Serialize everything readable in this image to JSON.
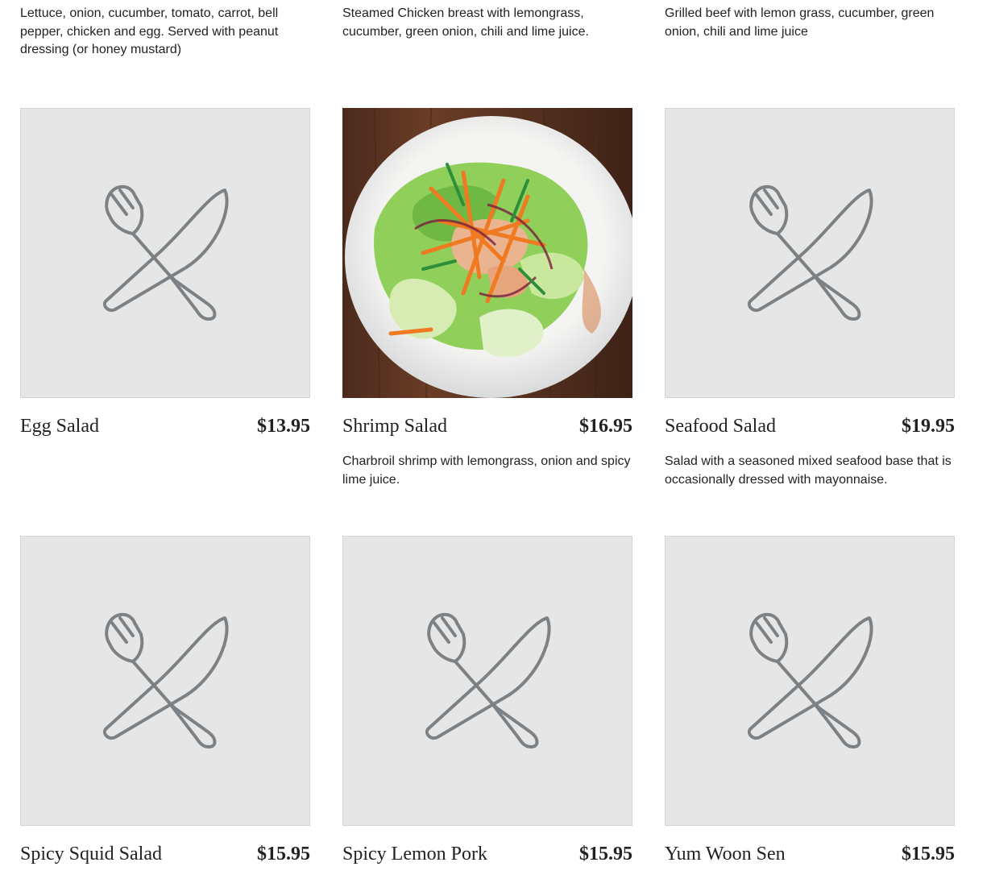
{
  "top_descriptions": [
    "Lettuce, onion, cucumber, tomato, carrot, bell pepper, chicken and egg. Served with peanut dressing (or honey mustard)",
    "Steamed Chicken breast with lemongrass, cucumber, green onion, chili and lime juice.",
    "Grilled beef with lemon grass, cucumber, green onion, chili and lime juice"
  ],
  "items": [
    {
      "name": "Egg Salad",
      "price": "$13.95",
      "description": "",
      "image": "placeholder-fork-knife-icon"
    },
    {
      "name": "Shrimp Salad",
      "price": "$16.95",
      "description": "Charbroil shrimp with lemongrass, onion and spicy lime juice.",
      "image": "salad-photo"
    },
    {
      "name": "Seafood Salad",
      "price": "$19.95",
      "description": "Salad with a seasoned mixed seafood base that is occasionally dressed with mayonnaise.",
      "image": "placeholder-fork-knife-icon"
    },
    {
      "name": "Spicy Squid Salad",
      "price": "$15.95",
      "description": "",
      "image": "placeholder-fork-knife-icon"
    },
    {
      "name": "Spicy Lemon Pork",
      "price": "$15.95",
      "description": "",
      "image": "placeholder-fork-knife-icon"
    },
    {
      "name": "Yum Woon Sen",
      "price": "$15.95",
      "description": "",
      "image": "placeholder-fork-knife-icon"
    }
  ],
  "colors": {
    "placeholder_bg": "#e6e6e6",
    "icon_stroke": "#7b8184",
    "text": "#222222"
  }
}
